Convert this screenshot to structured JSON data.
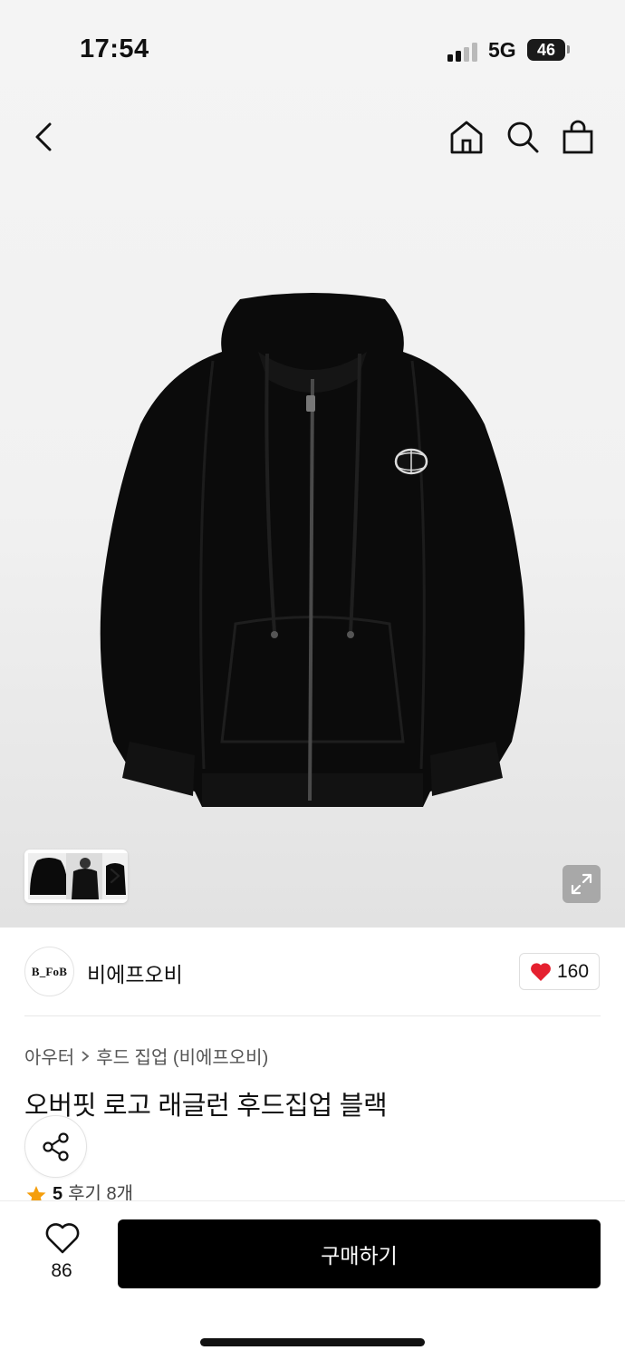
{
  "status_bar": {
    "time": "17:54",
    "network": "5G",
    "battery": "46"
  },
  "nav": {
    "back_icon": "chevron-left",
    "home_icon": "home",
    "search_icon": "magnifier",
    "bag_icon": "shopping-bag"
  },
  "gallery": {
    "thumbnail_count": 3,
    "expand_icon": "expand-arrows"
  },
  "brand": {
    "logo_text": "B_FoB",
    "name": "비에프오비",
    "likes": "160"
  },
  "breadcrumb": {
    "category": "아우터",
    "subcategory": "후드 집업 (비에프오비)"
  },
  "product": {
    "title": "오버핏 로고 래글런 후드집업 블랙"
  },
  "rating": {
    "score": "5",
    "reviews": "후기 8개"
  },
  "bottom_bar": {
    "wish_count": "86",
    "buy_label": "구매하기"
  },
  "colors": {
    "accent_heart": "#e5202f",
    "buy_button": "#000000",
    "star": "#f59e0b"
  }
}
